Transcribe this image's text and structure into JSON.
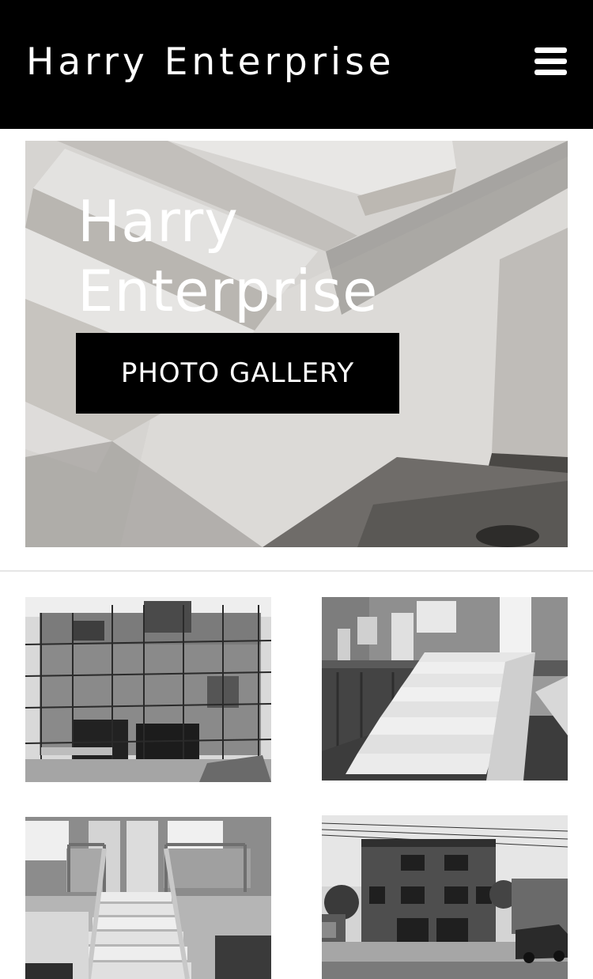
{
  "header": {
    "title": "Harry Enterprise",
    "menu_icon": "hamburger-menu-icon"
  },
  "hero": {
    "heading_line1": "Harry",
    "heading_line2": "Enterprise",
    "button_label": "PHOTO GALLERY",
    "image": "concrete-stairs-photo"
  },
  "gallery": {
    "photos": [
      "scaffolding-brick-house-photo",
      "concrete-stairs-townhouse-photo",
      "front-entrance-stairs-photo",
      "duplex-building-photo"
    ]
  }
}
